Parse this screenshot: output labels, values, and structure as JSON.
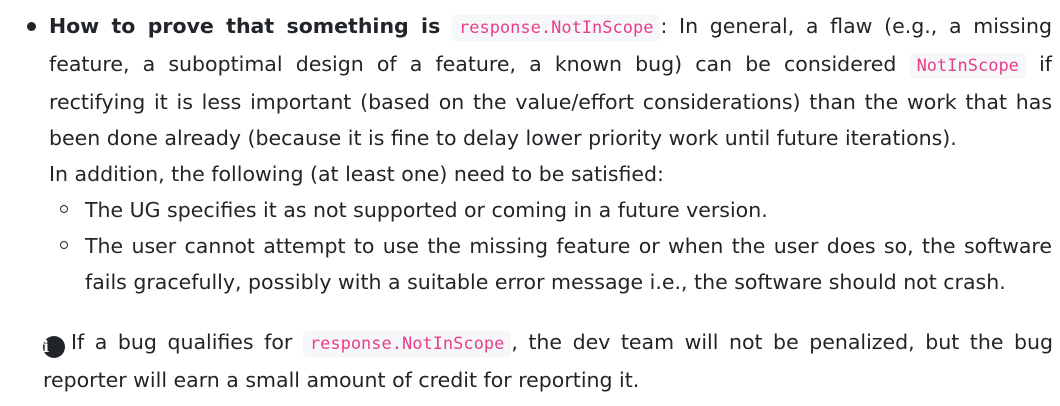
{
  "item": {
    "heading": "How to prove that something is",
    "heading_code": "response.NotInScope",
    "text1": ": In general, a flaw (e.g., a missing feature, a suboptimal design of a feature, a known bug) can be considered",
    "inline_code": "NotInScope",
    "text2": "if rectifying it is less important (based on the value/effort considerations) than the work that has been done already (because it is fine to delay lower priority work until future iterations).",
    "addition": "In addition, the following (at least one) need to be satisfied:",
    "subitems": [
      "The UG specifies it as not supported or coming in a future version.",
      "The user cannot attempt to use the missing feature or when the user does so, the software fails gracefully, possibly with a suitable error message i.e., the software should not crash."
    ]
  },
  "note": {
    "icon": "info-icon",
    "text1": "If a bug qualifies for",
    "code": "response.NotInScope",
    "text2": ", the dev team will not be penalized, but the bug reporter will earn a small amount of credit for reporting it."
  }
}
